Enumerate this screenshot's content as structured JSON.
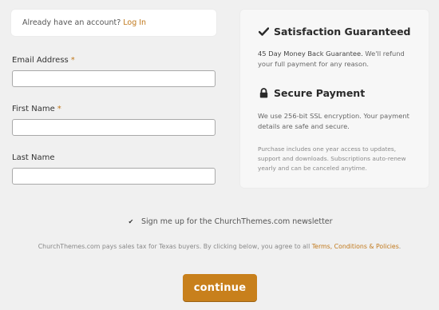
{
  "account": {
    "prompt": "Already have an account?",
    "login_link": "Log In"
  },
  "form": {
    "email": {
      "label": "Email Address",
      "required_mark": "*",
      "value": ""
    },
    "first_name": {
      "label": "First Name",
      "required_mark": "*",
      "value": ""
    },
    "last_name": {
      "label": "Last Name",
      "value": ""
    }
  },
  "guarantee": {
    "title": "Satisfaction Guaranteed",
    "highlight": "45 Day Money Back Guarantee.",
    "text": "We'll refund your full payment for any reason."
  },
  "secure": {
    "title": "Secure Payment",
    "text": "We use 256-bit SSL encryption. Your payment details are safe and secure.",
    "fine_print": "Purchase includes one year access to updates, support and downloads. Subscriptions auto-renew yearly and can be canceled anytime."
  },
  "newsletter": {
    "checked": true,
    "label": "Sign me up for the ChurchThemes.com newsletter"
  },
  "tax_notice": {
    "text": "ChurchThemes.com pays sales tax for Texas buyers. By clicking below, you agree to all",
    "link": "Terms, Conditions & Policies",
    "end": "."
  },
  "submit": {
    "label": "continue"
  },
  "colors": {
    "accent": "#c0781b",
    "button": "#c8801c"
  }
}
